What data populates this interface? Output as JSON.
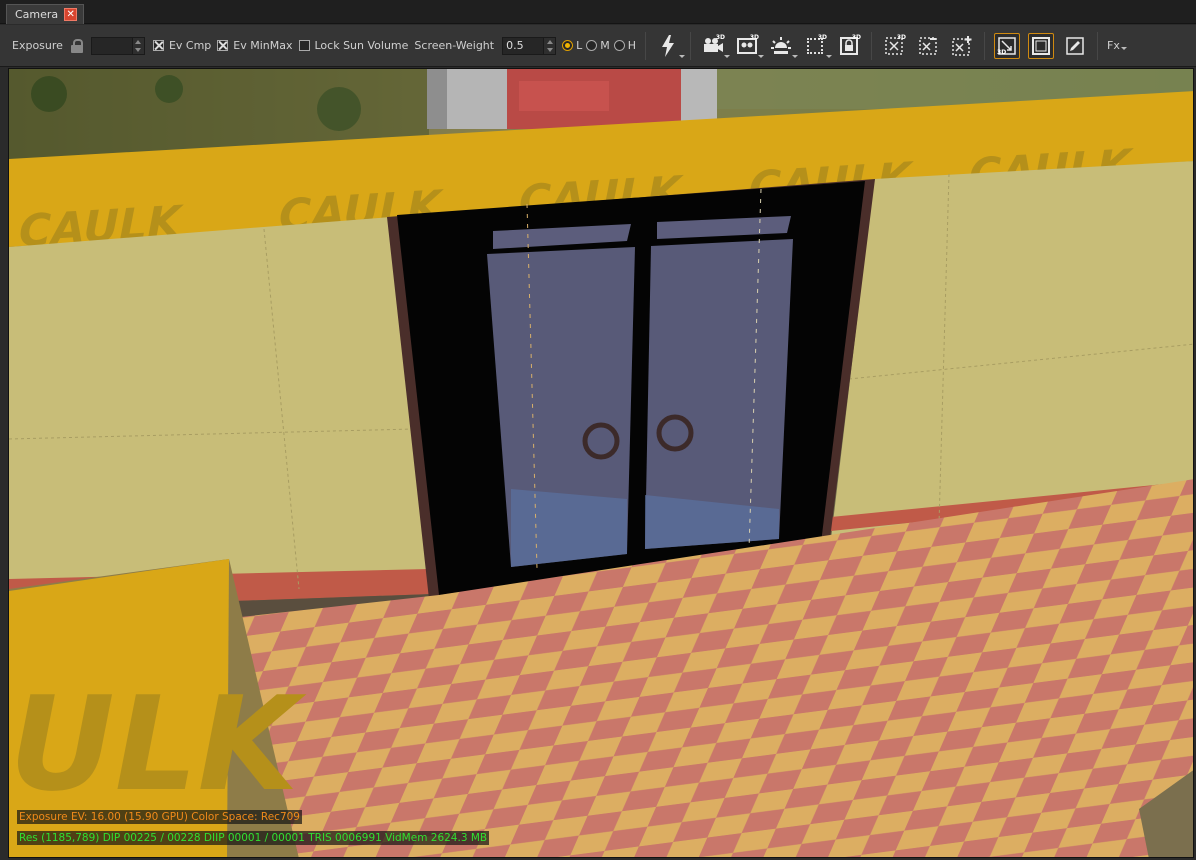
{
  "tab": {
    "label": "Camera",
    "close_glyph": "✕"
  },
  "toolbar": {
    "exposure_label": "Exposure",
    "exposure_value": "",
    "ev_cmp_label": "Ev Cmp",
    "ev_minmax_label": "Ev MinMax",
    "lock_sun_label": "Lock Sun Volume",
    "screen_weight_label": "Screen-Weight",
    "screen_weight_value": "0.5",
    "quality_low": "L",
    "quality_med": "M",
    "quality_high": "H",
    "fx_label": "Fx"
  },
  "checks": {
    "ev_cmp": true,
    "ev_minmax": true,
    "lock_sun": false
  },
  "quality_selected": "L",
  "viewport": {
    "texture_label": "CAULK"
  },
  "stats": {
    "line1": "Exposure EV: 16.00 (15.90 GPU)  Color Space: Rec709",
    "line2": "Res (1185,789)   DIP 00225 / 00228  DIIP 00001 / 00001  TRIS 0006991  VidMem 2624.3 MB"
  },
  "colors": {
    "accent": "#e0a000",
    "stat_orange": "#f08a1a",
    "stat_green": "#30e030",
    "caulk_yellow": "#d9a717",
    "wall_tan": "#c8bd78",
    "floor_salmon": "#c9776a",
    "floor_yellow": "#dcae62",
    "door_slate": "#585a78"
  }
}
